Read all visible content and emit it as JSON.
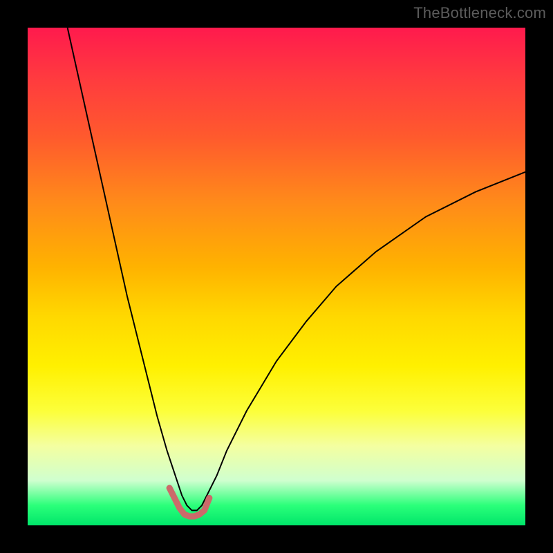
{
  "watermark": "TheBottleneck.com",
  "chart_data": {
    "type": "line",
    "title": "",
    "xlabel": "",
    "ylabel": "",
    "xlim": [
      0,
      100
    ],
    "ylim": [
      0,
      100
    ],
    "grid": false,
    "legend": false,
    "background_gradient": {
      "direction": "vertical",
      "stops": [
        {
          "pos": 0.0,
          "color": "#ff1a4d"
        },
        {
          "pos": 0.5,
          "color": "#ffd800"
        },
        {
          "pos": 0.85,
          "color": "#fcff80"
        },
        {
          "pos": 1.0,
          "color": "#00e66a"
        }
      ]
    },
    "series": [
      {
        "name": "bottleneck-curve",
        "color": "#000000",
        "width": 2,
        "x": [
          8,
          10,
          12,
          14,
          16,
          18,
          20,
          22,
          24,
          26,
          28,
          30,
          31,
          32,
          33,
          34,
          35,
          36,
          38,
          40,
          44,
          50,
          56,
          62,
          70,
          80,
          90,
          100
        ],
        "y": [
          100,
          91,
          82,
          73,
          64,
          55,
          46,
          38,
          30,
          22,
          15,
          9,
          6,
          4,
          3,
          3,
          4,
          6,
          10,
          15,
          23,
          33,
          41,
          48,
          55,
          62,
          67,
          71
        ]
      },
      {
        "name": "sweet-spot-markers",
        "color": "#cc6a6a",
        "width": 9,
        "x": [
          28.5,
          30.5,
          31.5,
          32.5,
          33.5,
          34.5,
          35.5,
          36.5
        ],
        "y": [
          7.5,
          3.5,
          2.2,
          1.8,
          1.8,
          2.2,
          3.0,
          5.5
        ]
      }
    ],
    "minimum": {
      "x": 33,
      "y": 1.8
    }
  }
}
